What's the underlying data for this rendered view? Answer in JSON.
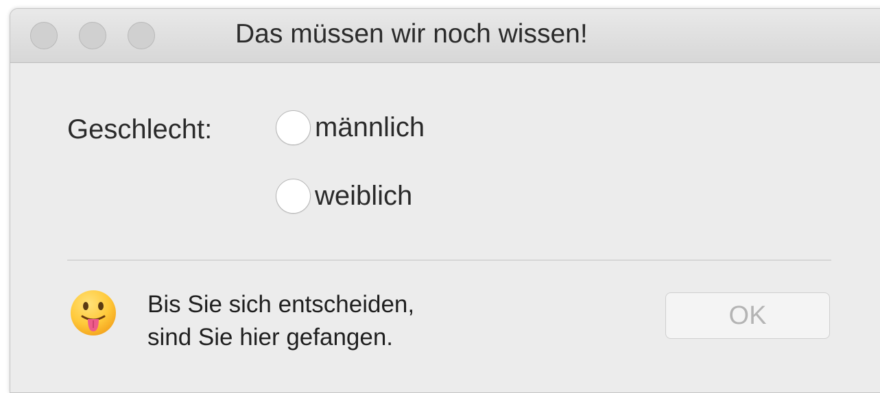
{
  "window": {
    "title": "Das müssen wir noch wissen!"
  },
  "form": {
    "label": "Geschlecht:",
    "options": [
      {
        "label": "männlich",
        "selected": false
      },
      {
        "label": "weiblich",
        "selected": false
      }
    ]
  },
  "footer": {
    "icon": "face-with-tongue-emoji",
    "message_line1": "Bis Sie sich entscheiden,",
    "message_line2": "sind Sie hier gefangen.",
    "ok_label": "OK",
    "ok_enabled": false
  }
}
